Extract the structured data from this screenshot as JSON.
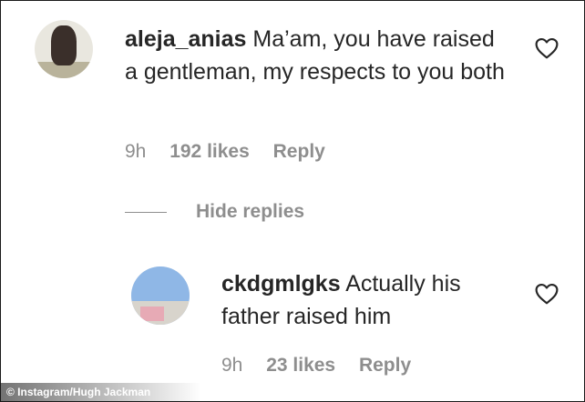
{
  "comments": [
    {
      "username": "aleja_anias",
      "text": "Ma’am, you have raised a gentleman, my respects to you both",
      "time": "9h",
      "likes": "192 likes",
      "reply_label": "Reply"
    }
  ],
  "hide_replies_label": "Hide replies",
  "replies": [
    {
      "username": "ckdgmlgks",
      "text": "Actually his father raised him",
      "time": "9h",
      "likes": "23 likes",
      "reply_label": "Reply"
    }
  ],
  "credit": "© Instagram/Hugh Jackman",
  "icons": {
    "like": "heart-outline-icon"
  },
  "colors": {
    "text": "#262626",
    "meta": "#8e8e8e"
  }
}
